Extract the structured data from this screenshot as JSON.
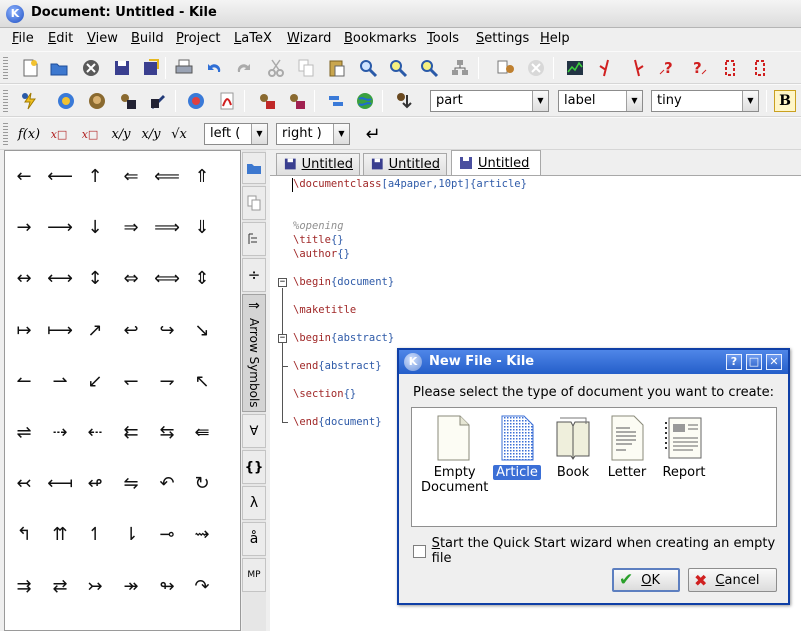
{
  "window": {
    "title": "Document: Untitled - Kile",
    "app_icon_letter": "K"
  },
  "menu": [
    "File",
    "Edit",
    "View",
    "Build",
    "Project",
    "LaTeX",
    "Wizard",
    "Bookmarks",
    "Tools",
    "Settings",
    "Help"
  ],
  "toolbar1": {
    "icons": [
      "new-file-icon",
      "open-file-icon",
      "close-file-icon",
      "save-icon",
      "save-all-icon",
      "print-icon",
      "undo-icon",
      "redo-icon",
      "cut-icon",
      "copy-icon",
      "paste-icon",
      "find-icon",
      "zoom-in-icon",
      "zoom-out-icon",
      "structure-icon",
      "view-document-icon",
      "stop-icon",
      "statistics-icon",
      "go-to-error-icon",
      "next-warning-icon",
      "previous-bad-box-icon",
      "next-bad-box-icon",
      "previous-bad-box-icon",
      "bibtex-warning-icon"
    ]
  },
  "toolbar2": {
    "icons": [
      "quick-build-icon",
      "latex-icon",
      "latex-to-ps-icon",
      "dvi-to-pdf-icon",
      "view-dvi-icon",
      "view-ps-icon",
      "pdflatex-icon",
      "view-pdf-icon",
      "convert-icon",
      "xml-icon",
      "html-view-icon",
      "web-icon",
      "bibtex-icon"
    ],
    "structure_value": "part",
    "label_value": "label",
    "size_value": "tiny",
    "bold_letter": "B"
  },
  "toolbar3": {
    "math_buttons": [
      "f(x)",
      "x□",
      "x□",
      "x/y",
      "x/y",
      "√x"
    ],
    "left_delimiter": "left (",
    "right_delimiter": "right )",
    "return_symbol": "↵"
  },
  "symbols": {
    "grid": [
      [
        "←",
        "⟵",
        "↑",
        "⇐",
        "⟸",
        "⇑"
      ],
      [
        "→",
        "⟶",
        "↓",
        "⇒",
        "⟹",
        "⇓"
      ],
      [
        "↔",
        "⟷",
        "↕",
        "⇔",
        "⟺",
        "⇕"
      ],
      [
        "↦",
        "⟼",
        "↗",
        "↩",
        "↪",
        "↘"
      ],
      [
        "↼",
        "⇀",
        "↙",
        "↽",
        "⇁",
        "↖"
      ],
      [
        "⇌",
        "⇢",
        "⇠",
        "⇇",
        "⇆",
        "⇚"
      ],
      [
        "↢",
        "⟻",
        "↫",
        "⇋",
        "↶",
        "↻"
      ],
      [
        "↰",
        "⇈",
        "↿",
        "⇂",
        "⊸",
        "⇝"
      ],
      [
        "⇉",
        "⇄",
        "↣",
        "↠",
        "↬",
        "↷"
      ]
    ]
  },
  "side_tabs": {
    "items": [
      "project-icon",
      "copy-icon",
      "structure-icon",
      "÷",
      "Arrow Symbols",
      "∀",
      "{}",
      "λ",
      "å",
      "MP"
    ],
    "active_label": "Arrow Symbols"
  },
  "tabs": [
    {
      "label": "Untitled"
    },
    {
      "label": "Untitled"
    },
    {
      "label": "Untitled"
    }
  ],
  "editor": {
    "line1_cmd": "\\documentclass",
    "line1_opt": "[a4paper,10pt]",
    "line1_arg": "{article}",
    "comment": "%opening",
    "title_cmd": "\\title",
    "title_arg": "{}",
    "author_cmd": "\\author",
    "author_arg": "{}",
    "begin_cmd": "\\begin",
    "begin_doc_arg": "{document}",
    "maketitle": "\\maketitle",
    "begin_abs_cmd": "\\begin",
    "begin_abs_arg": "{abstract}",
    "end_abs_cmd": "\\end",
    "end_abs_arg": "{abstract}",
    "section_cmd": "\\section",
    "section_arg": "{}",
    "end_doc_cmd": "\\end",
    "end_doc_arg": "{document}"
  },
  "dialog": {
    "title": "New File - Kile",
    "prompt": "Please select the type of document you want to create:",
    "types": [
      {
        "label": "Empty Document",
        "icon": "empty-document-icon"
      },
      {
        "label": "Article",
        "icon": "article-icon"
      },
      {
        "label": "Book",
        "icon": "book-icon"
      },
      {
        "label": "Letter",
        "icon": "letter-icon"
      },
      {
        "label": "Report",
        "icon": "report-icon"
      }
    ],
    "selected_type": "Article",
    "checkbox_label": "Start the Quick Start wizard when creating an empty file",
    "ok_label": "OK",
    "cancel_label": "Cancel",
    "help_symbol": "?",
    "maximize_symbol": "□",
    "close_symbol": "✕"
  }
}
